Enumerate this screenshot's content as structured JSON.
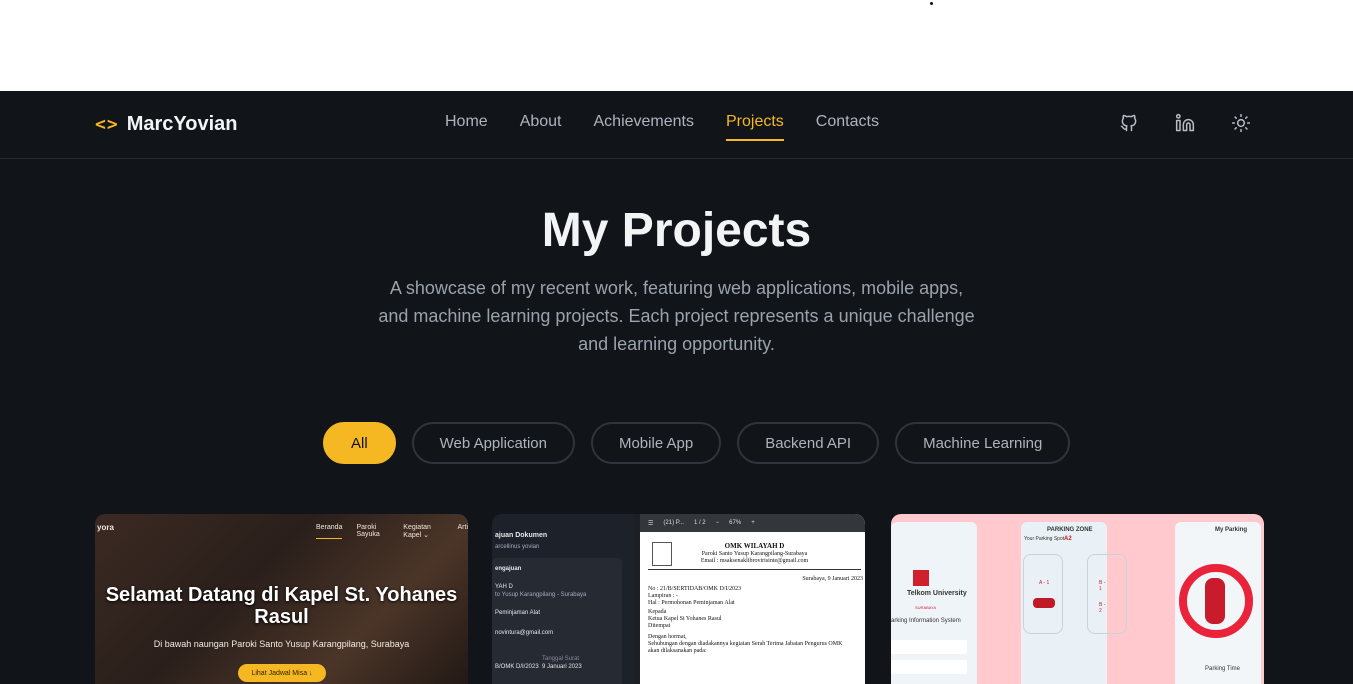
{
  "logo": {
    "icon": "<>",
    "name": "MarcYovian"
  },
  "nav": {
    "items": [
      {
        "label": "Home",
        "active": false
      },
      {
        "label": "About",
        "active": false
      },
      {
        "label": "Achievements",
        "active": false
      },
      {
        "label": "Projects",
        "active": true
      },
      {
        "label": "Contacts",
        "active": false
      }
    ]
  },
  "icons": [
    "github-icon",
    "linkedin-icon",
    "sun-icon"
  ],
  "hero": {
    "title": "My Projects",
    "subtitle": "A showcase of my recent work, featuring web applications, mobile apps, and machine learning projects. Each project represents a unique challenge and learning opportunity."
  },
  "filters": [
    {
      "label": "All",
      "active": true
    },
    {
      "label": "Web Application",
      "active": false
    },
    {
      "label": "Mobile App",
      "active": false
    },
    {
      "label": "Backend API",
      "active": false
    },
    {
      "label": "Machine Learning",
      "active": false
    }
  ],
  "cards": {
    "card1": {
      "brand": "yora",
      "links": [
        "Beranda",
        "Paroki Sayuka",
        "Kegiatan Kapel ⌄",
        "Arti"
      ],
      "title": "Selamat Datang di Kapel St. Yohanes Rasul",
      "subtitle": "Di bawah naungan Paroki Santo Yusup Karangpilang, Surabaya",
      "button": "Lihat Jadwal Misa ↓"
    },
    "card2": {
      "left_title": "ajuan Dokumen",
      "left_user": "arcellinus yovian",
      "left_section": "engajuan",
      "left_lines": [
        "YAH D",
        "to Yusup Karangpilang - Surabaya",
        "Peminjaman Alat",
        "novintura@gmail.com",
        "B/OMK D/I/2023",
        "9 Januari 2023"
      ],
      "left_label": "Tanggal Surat",
      "toolbar": [
        "☰",
        "(21) P...",
        "1 / 2",
        "−",
        "67%",
        "+"
      ],
      "doc_heading": "OMK WILAYAH D",
      "doc_sub1": "Paroki Santo Yusup Karangpilang-Surabaya",
      "doc_sub2": "Email : msaksenaklibrovirisinte@gmail.com",
      "doc_date": "Surabaya, 9 Januari 2023",
      "doc_lines": [
        "No        : 21/B/SERTIDAB/OMK D/I/2023",
        "Lampiran  : -",
        "Hal       : Permohonan Peminjaman Alat",
        "Kepada",
        "Ketua Kapel St Yohanes Rasul",
        "Ditempat",
        "Dengan hormat,",
        "Sehubungan dengan diadakannya kegiatan Serah Terima Jabatan Pengurus OMK",
        "akan dilaksanakan pada:"
      ]
    },
    "card3": {
      "logo_text": "Telkom University",
      "logo_sub": "SURABAYA",
      "p1_title": "arking Information System",
      "p2_header": "PARKING ZONE",
      "p2_spot_label": "Your Parking Spot :",
      "p2_spot": "A2",
      "p2_slots": [
        "A - 1",
        "B - 1",
        "B - 2"
      ],
      "p3_header": "My Parking",
      "p3_footer": "Parking Time"
    }
  },
  "colors": {
    "accent": "#f5b823",
    "bg": "#111419",
    "text": "#e7e9ec",
    "muted": "#9aa2ad"
  }
}
